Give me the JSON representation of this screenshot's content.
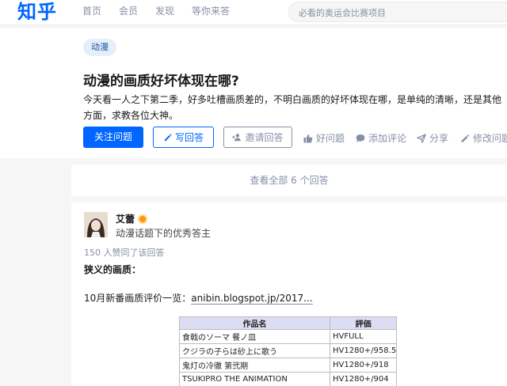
{
  "header": {
    "logo": "知乎",
    "nav": [
      "首页",
      "会员",
      "发现",
      "等你来答"
    ],
    "search_placeholder": "必看的奥运会比赛项目"
  },
  "question": {
    "tag": "动漫",
    "title": "动漫的画质好坏体现在哪?",
    "description": "今天看一人之下第二季，好多吐槽画质差的，不明白画质的好坏体现在哪，是单纯的清晰，还是其他方面，求教各位大神。",
    "buttons": {
      "follow": "关注问题",
      "write": "写回答",
      "invite": "邀请回答"
    },
    "actions": {
      "good": "好问题",
      "comment": "添加评论",
      "share": "分享",
      "edit": "修改问题"
    }
  },
  "view_all": "查看全部 6 个回答",
  "answer": {
    "author": "艾蕾",
    "headline": "动漫话题下的优秀答主",
    "votes": "150 人赞同了该回答",
    "para1": "狭义的画质：",
    "para2_prefix": "10月新番画质评价一览：",
    "link": "anibin.blogspot.jp/2017...",
    "table": {
      "headers": [
        "作品名",
        "評価"
      ],
      "rows": [
        [
          "食戟のソーマ 餐ノ皿",
          "HVFULL"
        ],
        [
          "クジラの子らは砂上に歌う",
          "HV1280+/958.5"
        ],
        [
          "鬼灯の冷徹 第弐期",
          "HV1280+/918"
        ],
        [
          "TSUKIPRO THE ANIMATION",
          "HV1280+/904"
        ]
      ]
    }
  },
  "colors": {
    "brand": "#0066ff",
    "muted": "#8590a6",
    "tag_bg": "#e5effa",
    "tag_text": "#175199"
  }
}
